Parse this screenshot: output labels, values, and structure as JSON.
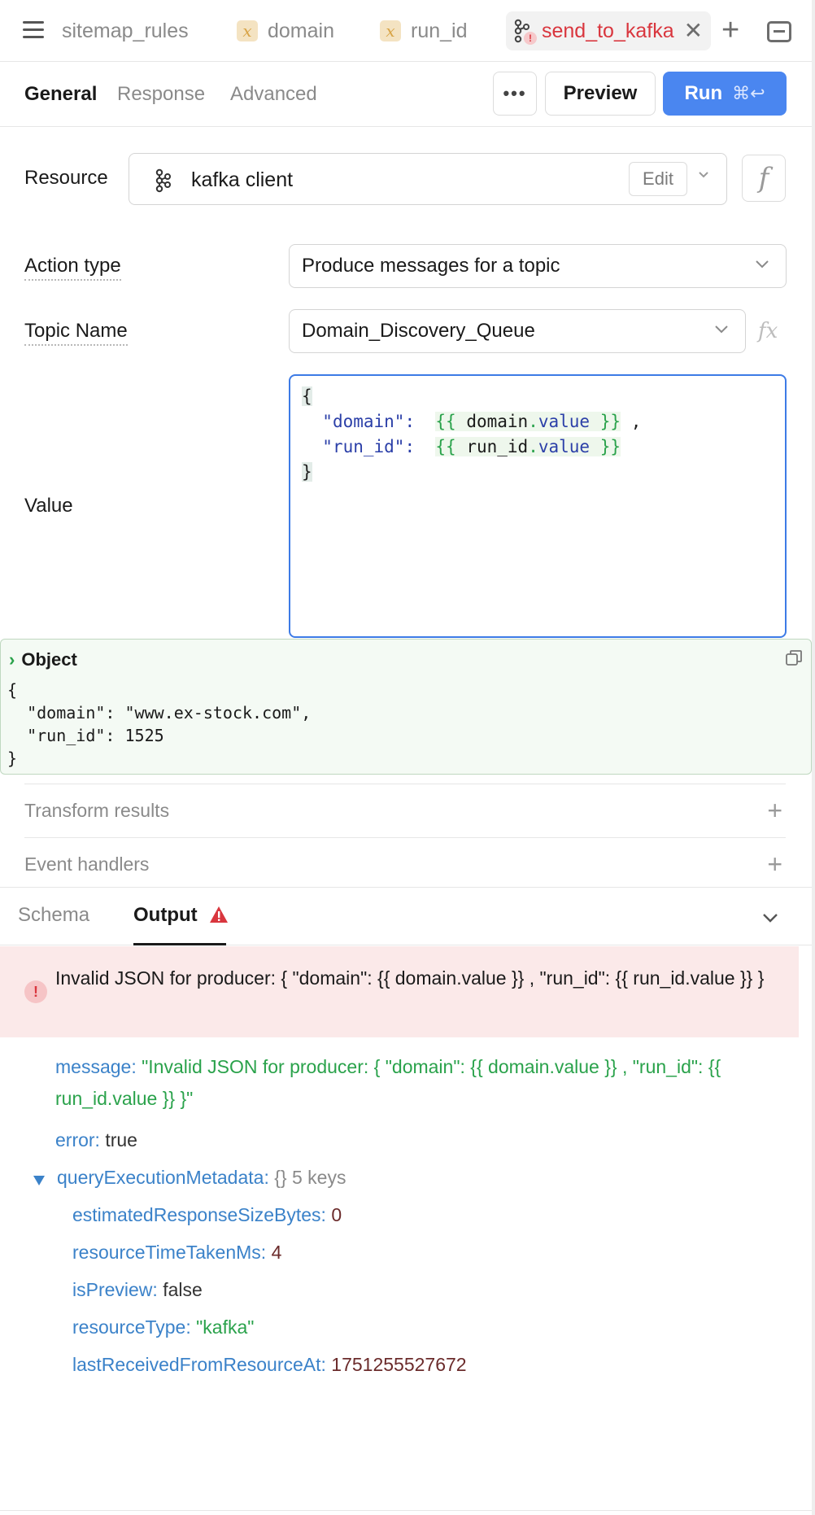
{
  "tabs": [
    {
      "label": "sitemap_rules"
    },
    {
      "label": "domain",
      "icon": "variable-icon"
    },
    {
      "label": "run_id",
      "icon": "variable-icon"
    },
    {
      "label": "send_to_kafka",
      "icon": "kafka-icon",
      "active": true,
      "status": "error"
    }
  ],
  "subtabs": {
    "general": "General",
    "response": "Response",
    "advanced": "Advanced"
  },
  "toolbar": {
    "more": "•••",
    "preview": "Preview",
    "run": "Run",
    "run_shortcut": "⌘↩"
  },
  "form": {
    "resource_label": "Resource",
    "resource_value": "kafka client",
    "edit_label": "Edit",
    "action_type_label": "Action type",
    "action_type_value": "Produce messages for a topic",
    "topic_label": "Topic Name",
    "topic_value": "Domain_Discovery_Queue",
    "value_label": "Value"
  },
  "code": {
    "open": "{",
    "line1_key": "\"domain\":",
    "line1_tpl_open": "{{",
    "line1_obj": "domain",
    "line1_prop": "value",
    "line1_tpl_close": "}}",
    "line1_comma": ",",
    "line2_key": "\"run_id\":",
    "line2_tpl_open": "{{",
    "line2_obj": "run_id",
    "line2_prop": "value",
    "line2_tpl_close": "}}",
    "close": "}"
  },
  "preview": {
    "title": "Object",
    "body": "{\n  \"domain\": \"www.ex-stock.com\",\n  \"run_id\": 1525\n}"
  },
  "sections": {
    "transform": "Transform results",
    "events": "Event handlers"
  },
  "output_tabs": {
    "schema": "Schema",
    "output": "Output"
  },
  "error": {
    "text": "Invalid JSON for producer: { \"domain\": {{ domain.value }} , \"run_id\": {{ run_id.value }} }"
  },
  "result": {
    "message_key": "message:",
    "message_value": "\"Invalid JSON for producer: { \"domain\": {{ domain.value }} , \"run_id\": {{ run_id.value }} }\"",
    "error_key": "error:",
    "error_value": "true",
    "meta_key": "queryExecutionMetadata:",
    "meta_summary": "{}  5 keys",
    "meta": [
      {
        "key": "estimatedResponseSizeBytes:",
        "value": "0"
      },
      {
        "key": "resourceTimeTakenMs:",
        "value": "4"
      },
      {
        "key": "isPreview:",
        "value": "false"
      },
      {
        "key": "resourceType:",
        "value": "\"kafka\""
      },
      {
        "key": "lastReceivedFromResourceAt:",
        "value": "1751255527672"
      }
    ]
  },
  "colors": {
    "accent": "#4a86f0",
    "error": "#d9363e",
    "string": "#2aa24b",
    "key": "#3b82c9"
  }
}
